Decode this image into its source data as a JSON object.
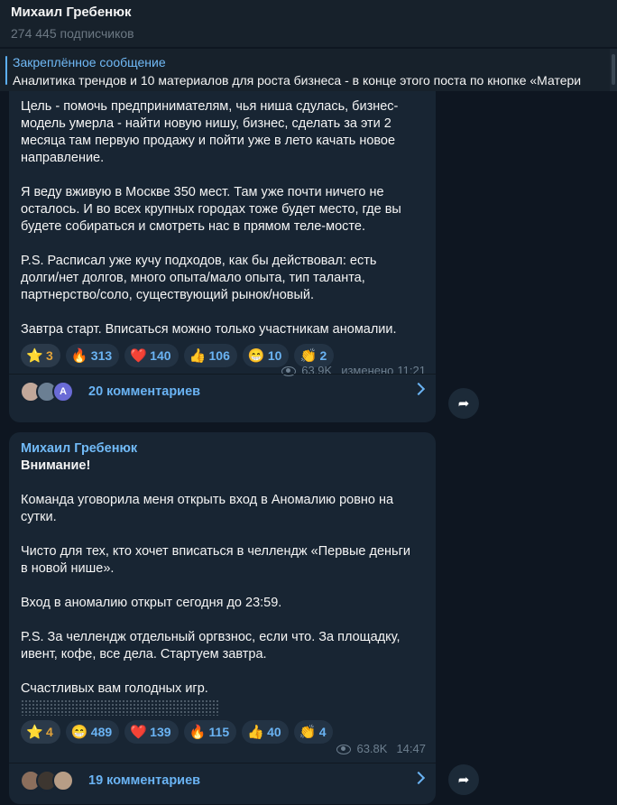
{
  "header": {
    "channel_name": "Михаил Гребенюк",
    "subscribers": "274 445 подписчиков"
  },
  "pinned": {
    "title": "Закреплённое сообщение",
    "text": "Аналитика трендов и 10 материалов для роста бизнеса - в конце этого поста по кнопке «Матери"
  },
  "messages": [
    {
      "paragraphs": [
        "Цель - помочь предпринимателям, чья ниша сдулась, бизнес-\nмодель умерла - найти новую нишу, бизнес, сделать за эти 2\nмесяца там первую продажу и пойти уже в лето качать новое\nнаправление.",
        "Я веду вживую в Москве 350 мест. Там уже почти ничего не\nосталось. И во всех крупных городах тоже будет место, где вы\nбудете собираться и смотреть нас в прямом теле-мосте.",
        "P.S. Расписал уже кучу подходов, как бы действовал: есть\nдолги/нет долгов, много опыта/мало опыта, тип таланта,\nпартнерство/соло, существующий рынок/новый.",
        "Завтра старт. Вписаться можно только участникам аномалии."
      ],
      "reactions": [
        {
          "emoji": "⭐",
          "count": "3"
        },
        {
          "emoji": "🔥",
          "count": "313"
        },
        {
          "emoji": "❤️",
          "count": "140"
        },
        {
          "emoji": "👍",
          "count": "106"
        },
        {
          "emoji": "😁",
          "count": "10"
        },
        {
          "emoji": "👏",
          "count": "2"
        }
      ],
      "views": "63.9K",
      "edited": "изменено",
      "time": "11:21",
      "comments": "20 комментариев",
      "avatar_letter": "A"
    },
    {
      "sender": "Михаил Гребенюк",
      "title": "Внимание!",
      "paragraphs": [
        "Команда уговорила меня открыть вход в Аномалию ровно на\nсутки.",
        "Чисто для тех, кто хочет вписаться в челлендж «Первые деньги\nв новой нише».",
        "Вход в аномалию открыт сегодня до 23:59.",
        "P.S. За челлендж отдельный оргвзнос, если что. За площадку,\nивент, кофе, все дела. Стартуем завтра.",
        "Счастливых вам голодных игр."
      ],
      "reactions": [
        {
          "emoji": "⭐",
          "count": "4"
        },
        {
          "emoji": "😁",
          "count": "489"
        },
        {
          "emoji": "❤️",
          "count": "139"
        },
        {
          "emoji": "🔥",
          "count": "115"
        },
        {
          "emoji": "👍",
          "count": "40"
        },
        {
          "emoji": "👏",
          "count": "4"
        }
      ],
      "views": "63.8K",
      "time": "14:47",
      "comments": "19 комментариев"
    }
  ],
  "icons": {
    "share": "share-arrow-icon",
    "views": "eye-icon",
    "comments_chevron": "chevron-right-icon"
  }
}
